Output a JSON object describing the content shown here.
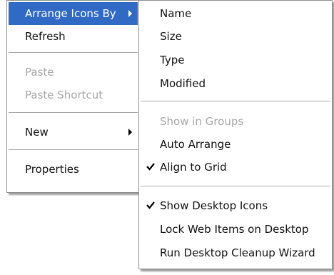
{
  "context_menu": {
    "arrange_icons_by": "Arrange Icons By",
    "refresh": "Refresh",
    "paste": "Paste",
    "paste_shortcut": "Paste Shortcut",
    "new": "New",
    "properties": "Properties"
  },
  "arrange_submenu": {
    "name": "Name",
    "size": "Size",
    "type": "Type",
    "modified": "Modified",
    "show_in_groups": "Show in Groups",
    "auto_arrange": "Auto Arrange",
    "align_to_grid": "Align to Grid",
    "show_desktop_icons": "Show Desktop Icons",
    "lock_web_items": "Lock Web Items on Desktop",
    "run_cleanup_wizard": "Run Desktop Cleanup Wizard"
  },
  "colors": {
    "selection": "#316ac5",
    "disabled_text": "#a6a6a6"
  },
  "icons": {
    "submenu_arrow": "right-triangle",
    "checkmark": "check"
  }
}
